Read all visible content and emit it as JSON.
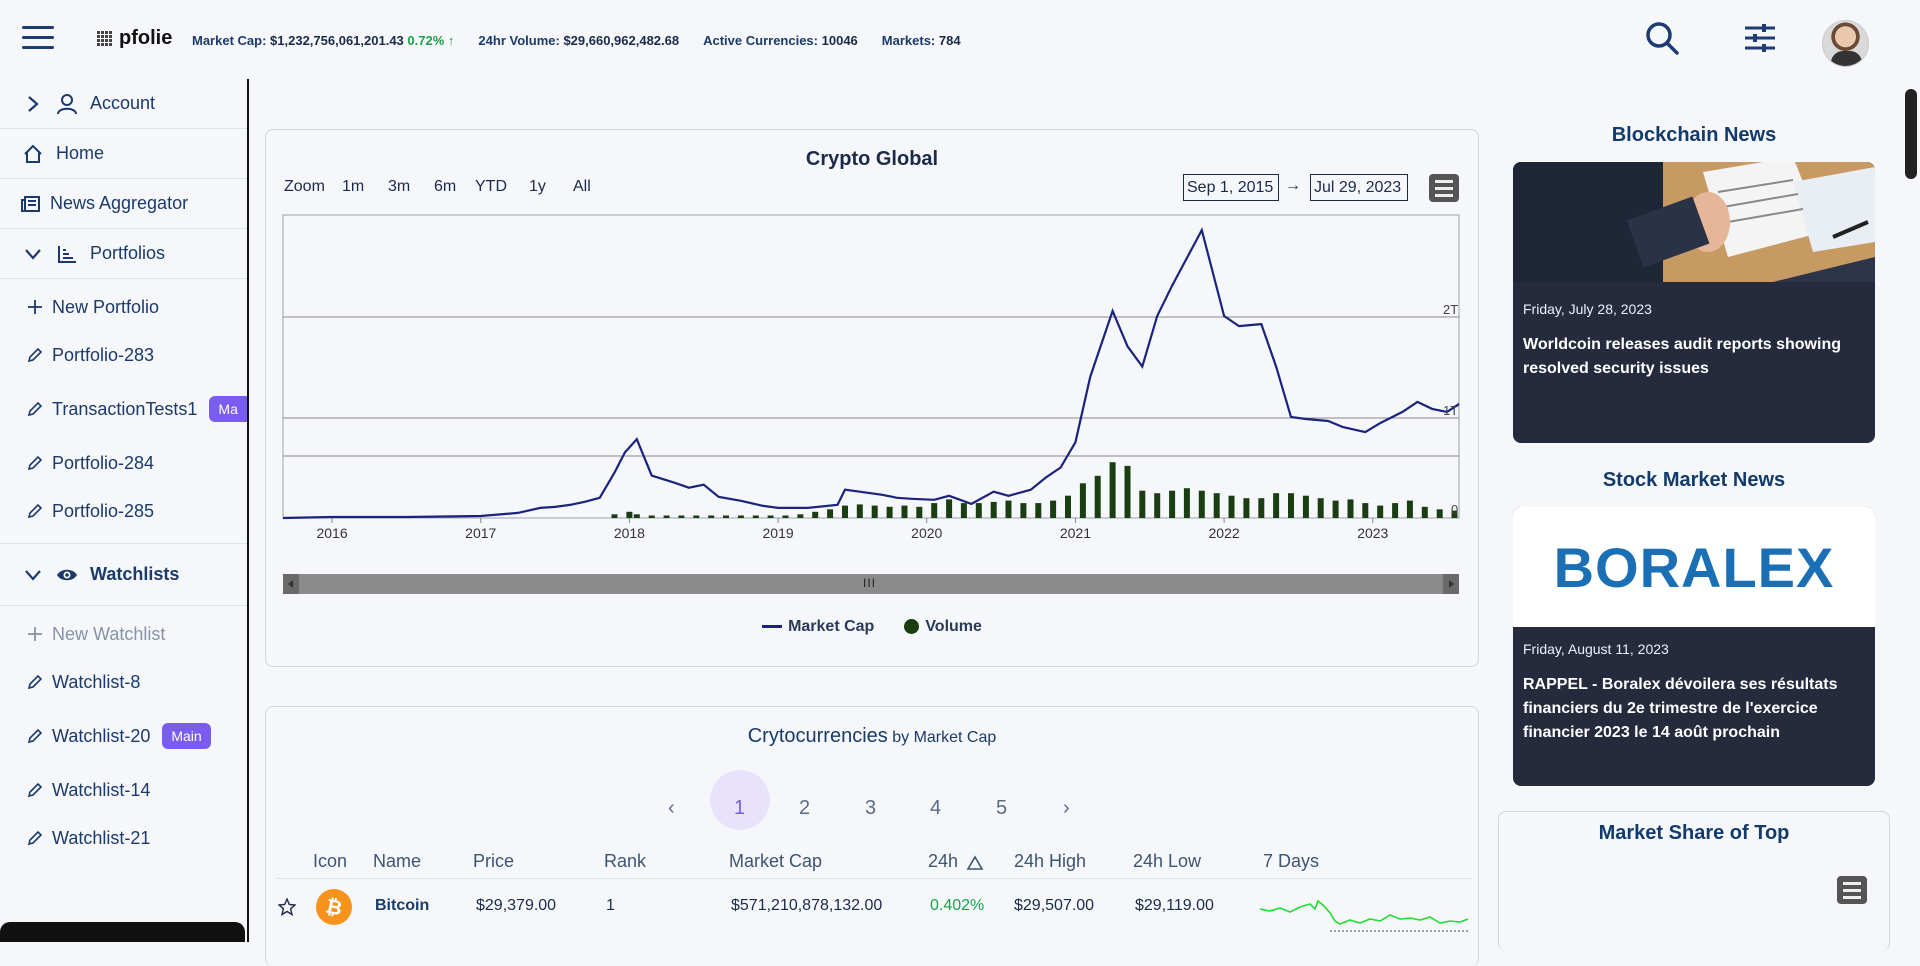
{
  "header": {
    "logo": "pfolie",
    "market_cap_label": "Market Cap:",
    "market_cap_value": "$1,232,756,061,201.43",
    "market_cap_change": "0.72%",
    "volume_label": "24hr Volume:",
    "volume_value": "$29,660,962,482.68",
    "currencies_label": "Active Currencies:",
    "currencies_value": "10046",
    "markets_label": "Markets:",
    "markets_value": "784"
  },
  "sidebar": {
    "account": "Account",
    "home": "Home",
    "news": "News Aggregator",
    "portfolios": "Portfolios",
    "new_portfolio": "New Portfolio",
    "portfolio_items": [
      {
        "label": "Portfolio-283",
        "badge": ""
      },
      {
        "label": "TransactionTests1",
        "badge": "Ma"
      },
      {
        "label": "Portfolio-284",
        "badge": ""
      },
      {
        "label": "Portfolio-285",
        "badge": ""
      }
    ],
    "watchlists": "Watchlists",
    "new_watchlist": "New Watchlist",
    "watchlist_items": [
      {
        "label": "Watchlist-8",
        "badge": ""
      },
      {
        "label": "Watchlist-20",
        "badge": "Main"
      },
      {
        "label": "Watchlist-14",
        "badge": ""
      },
      {
        "label": "Watchlist-21",
        "badge": ""
      }
    ]
  },
  "chart_card": {
    "title": "Crypto Global",
    "zoom_label": "Zoom",
    "ranges": [
      "1m",
      "3m",
      "6m",
      "YTD",
      "1y",
      "All"
    ],
    "date_from": "Sep 1, 2015",
    "arrow": "→",
    "date_to": "Jul 29, 2023",
    "legend_market_cap": "Market Cap",
    "legend_volume": "Volume",
    "scroll_grip": "III"
  },
  "chart_data": {
    "type": "line",
    "title": "Crypto Global",
    "x_tick_labels": [
      "2016",
      "2017",
      "2018",
      "2019",
      "2020",
      "2021",
      "2022",
      "2023"
    ],
    "y_tick_labels": [
      "2T",
      "1T",
      "0"
    ],
    "series": [
      {
        "name": "Market Cap",
        "type": "line",
        "color": "#1a237e",
        "x": [
          2015.67,
          2016.0,
          2016.5,
          2017.0,
          2017.25,
          2017.4,
          2017.5,
          2017.6,
          2017.7,
          2017.8,
          2017.9,
          2017.97,
          2018.05,
          2018.15,
          2018.3,
          2018.4,
          2018.5,
          2018.6,
          2018.75,
          2018.9,
          2019.0,
          2019.2,
          2019.4,
          2019.45,
          2019.55,
          2019.7,
          2019.8,
          2019.9,
          2020.05,
          2020.15,
          2020.3,
          2020.45,
          2020.55,
          2020.7,
          2020.8,
          2020.9,
          2021.0,
          2021.1,
          2021.25,
          2021.35,
          2021.45,
          2021.55,
          2021.65,
          2021.85,
          2022.0,
          2022.1,
          2022.25,
          2022.35,
          2022.45,
          2022.55,
          2022.7,
          2022.8,
          2022.95,
          2023.05,
          2023.2,
          2023.3,
          2023.4,
          2023.5,
          2023.58
        ],
        "values": [
          0.0,
          0.01,
          0.01,
          0.02,
          0.05,
          0.1,
          0.11,
          0.13,
          0.16,
          0.2,
          0.45,
          0.65,
          0.78,
          0.42,
          0.35,
          0.3,
          0.33,
          0.21,
          0.17,
          0.12,
          0.1,
          0.1,
          0.13,
          0.28,
          0.26,
          0.23,
          0.2,
          0.19,
          0.18,
          0.22,
          0.14,
          0.26,
          0.22,
          0.28,
          0.4,
          0.5,
          0.75,
          1.4,
          2.05,
          1.7,
          1.5,
          2.0,
          2.3,
          2.85,
          2.0,
          1.9,
          1.92,
          1.5,
          1.0,
          0.98,
          0.96,
          0.9,
          0.85,
          0.94,
          1.05,
          1.15,
          1.08,
          1.05,
          1.13
        ]
      },
      {
        "name": "Volume",
        "type": "bar",
        "color": "#1b3d12",
        "x": [
          2017.9,
          2018.0,
          2018.05,
          2018.15,
          2018.25,
          2018.35,
          2018.45,
          2018.55,
          2018.65,
          2018.75,
          2018.85,
          2018.95,
          2019.05,
          2019.15,
          2019.25,
          2019.35,
          2019.45,
          2019.55,
          2019.65,
          2019.75,
          2019.85,
          2019.95,
          2020.05,
          2020.15,
          2020.25,
          2020.35,
          2020.45,
          2020.55,
          2020.65,
          2020.75,
          2020.85,
          2020.95,
          2021.05,
          2021.15,
          2021.25,
          2021.35,
          2021.45,
          2021.55,
          2021.65,
          2021.75,
          2021.85,
          2021.95,
          2022.05,
          2022.15,
          2022.25,
          2022.35,
          2022.45,
          2022.55,
          2022.65,
          2022.75,
          2022.85,
          2022.95,
          2023.05,
          2023.15,
          2023.25,
          2023.35,
          2023.45,
          2023.55
        ],
        "values": [
          0.03,
          0.05,
          0.03,
          0.02,
          0.02,
          0.02,
          0.02,
          0.02,
          0.02,
          0.02,
          0.02,
          0.02,
          0.02,
          0.03,
          0.05,
          0.07,
          0.1,
          0.11,
          0.1,
          0.09,
          0.1,
          0.09,
          0.12,
          0.15,
          0.12,
          0.12,
          0.13,
          0.14,
          0.12,
          0.12,
          0.14,
          0.18,
          0.28,
          0.34,
          0.45,
          0.42,
          0.22,
          0.2,
          0.22,
          0.24,
          0.22,
          0.2,
          0.18,
          0.16,
          0.16,
          0.2,
          0.2,
          0.18,
          0.16,
          0.14,
          0.15,
          0.12,
          0.1,
          0.12,
          0.14,
          0.09,
          0.07,
          0.06
        ]
      }
    ]
  },
  "crypto_table": {
    "title": "Crytocurrencies",
    "subtitle": "by Market Cap",
    "pages": [
      "1",
      "2",
      "3",
      "4",
      "5"
    ],
    "prev": "‹",
    "next": "›",
    "columns": [
      "Icon",
      "Name",
      "Price",
      "Rank",
      "Market Cap",
      "24h",
      "24h High",
      "24h Low",
      "7 Days"
    ],
    "rows": [
      {
        "name": "Bitcoin",
        "price": "$29,379.00",
        "rank": "1",
        "market_cap": "$571,210,878,132.00",
        "change": "0.402%",
        "high": "$29,507.00",
        "low": "$29,119.00"
      }
    ]
  },
  "news": {
    "blockchain_head": "Blockchain News",
    "blockchain": {
      "date": "Friday, July 28, 2023",
      "title": "Worldcoin releases audit reports showing resolved security issues"
    },
    "stock_head": "Stock Market News",
    "stock": {
      "logo": "BORALEX",
      "date": "Friday, August 11, 2023",
      "title": "RAPPEL - Boralex dévoilera ses résultats financiers du 2e trimestre de l'exercice financier 2023 le 14 août prochain"
    },
    "share_head": "Market Share of Top"
  }
}
